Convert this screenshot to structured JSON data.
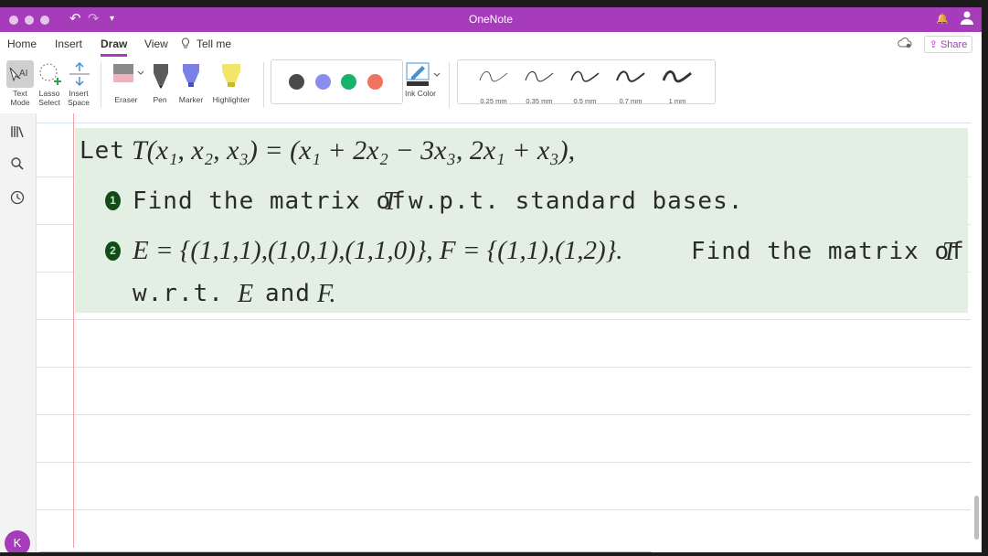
{
  "app": {
    "title": "OneNote",
    "accent": "#a63cba"
  },
  "tabs": [
    {
      "label": "Home",
      "active": false
    },
    {
      "label": "Insert",
      "active": false
    },
    {
      "label": "Draw",
      "active": true
    },
    {
      "label": "View",
      "active": false
    },
    {
      "label": "Tell me",
      "active": false
    }
  ],
  "share_label": "Share",
  "ribbon": {
    "text_mode": "Text Mode",
    "lasso_select": "Lasso Select",
    "insert_space": "Insert Space",
    "eraser": "Eraser",
    "pen": "Pen",
    "marker": "Marker",
    "highlighter": "Highlighter",
    "ink_color": "Ink Color",
    "colors": [
      "#4a4a4a",
      "#8a8cf0",
      "#17b26b",
      "#f0735f"
    ],
    "thicknesses": [
      "0.25 mm",
      "0.35 mm",
      "0.5 mm",
      "0.7 mm",
      "1 mm"
    ]
  },
  "note": {
    "line1_let": "Let",
    "line1_math": "T(x₁, x₂, x₃) = (x₁ + 2x₂ − 3x₃, 2x₁ + x₃),",
    "item1_num": "1",
    "item1_text": "Find the matrix of",
    "item1_T": "T",
    "item1_rest": "w.p.t.  standard bases.",
    "item2_num": "2",
    "item2_math": "E = {(1,1,1),(1,0,1),(1,1,0)},  F = {(1,1),(1,2)}.",
    "item2_text": "Find the matrix of",
    "item2_T": "T",
    "item2_line2a": "w.r.t.",
    "item2_E": "E",
    "item2_and": "and",
    "item2_F": "F."
  },
  "user_initial": "K"
}
